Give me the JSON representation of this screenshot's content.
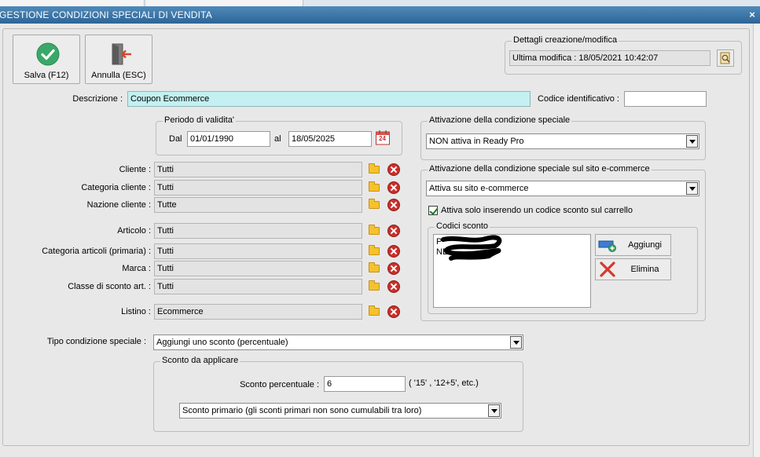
{
  "window": {
    "title": "GESTIONE CONDIZIONI SPECIALI DI VENDITA",
    "close_glyph": "×"
  },
  "toolbar": {
    "save_label": "Salva (F12)",
    "cancel_label": "Annulla (ESC)",
    "save_icon": "check-circle-icon",
    "cancel_icon": "exit-door-icon"
  },
  "details": {
    "group_title": "Dettagli creazione/modifica",
    "last_modified": "Ultima modifica : 18/05/2021  10:42:07"
  },
  "descrizione": {
    "label": "Descrizione :",
    "value": "Coupon Ecommerce"
  },
  "codice": {
    "label": "Codice identificativo :",
    "value": ""
  },
  "validity": {
    "group_title": "Periodo di validita'",
    "from_label": "Dal",
    "from_value": "01/01/1990",
    "to_label": "al",
    "to_value": "18/05/2025",
    "calendar_icon": "calendar-icon",
    "calendar_day": "24"
  },
  "filters": [
    {
      "label": "Cliente :",
      "value": "Tutti"
    },
    {
      "label": "Categoria cliente :",
      "value": "Tutti"
    },
    {
      "label": "Nazione cliente :",
      "value": "Tutte"
    },
    {
      "label": "Articolo :",
      "value": "Tutti"
    },
    {
      "label": "Categoria articoli (primaria) :",
      "value": "Tutti"
    },
    {
      "label": "Marca :",
      "value": "Tutti"
    },
    {
      "label": "Classe di sconto art. :",
      "value": "Tutti"
    },
    {
      "label": "Listino :",
      "value": "Ecommerce"
    }
  ],
  "activation": {
    "group_title": "Attivazione della condizione speciale",
    "selected": "NON attiva in Ready Pro"
  },
  "ecommerce": {
    "group_title": "Attivazione della condizione speciale sul sito e-commerce",
    "selected": "Attiva su sito e-commerce",
    "checkbox_label": "Attiva solo inserendo un codice sconto sul carrello",
    "checkbox_checked": true,
    "codes_group_title": "Codici sconto",
    "codes": [
      "P",
      "NE"
    ],
    "add_label": "Aggiungi",
    "delete_label": "Elimina"
  },
  "tipo": {
    "label": "Tipo condizione speciale :",
    "selected": "Aggiungi uno sconto (percentuale)"
  },
  "sconto": {
    "group_title": "Sconto da applicare",
    "percent_label": "Sconto percentuale :",
    "percent_value": "6",
    "hint": "( '15' , '12+5', etc.)",
    "type_selected": "Sconto primario (gli sconti primari non sono cumulabili tra loro)"
  },
  "colors": {
    "titlebar": "#2d6598",
    "description_bg": "#c4f0f1",
    "save_green": "#3aa868",
    "delete_red": "#c9302c",
    "folder_yellow": "#f6c22b"
  }
}
